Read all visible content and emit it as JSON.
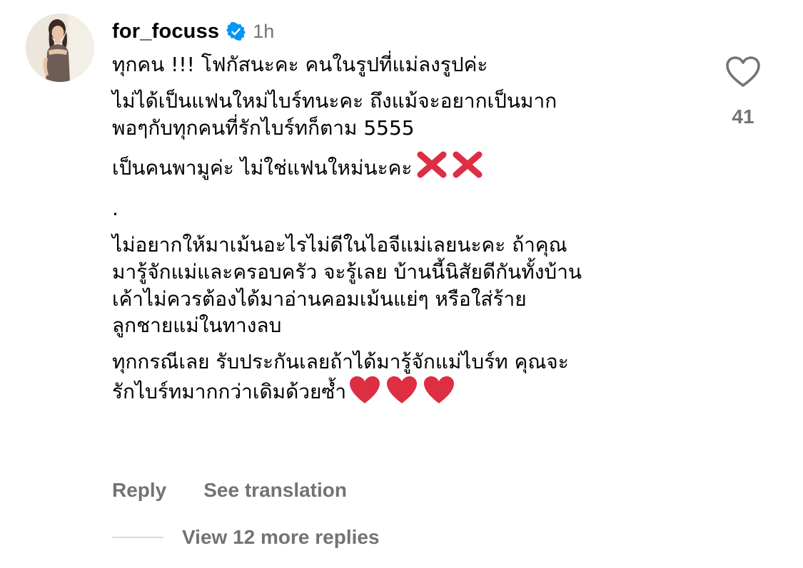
{
  "comment": {
    "username": "for_focuss",
    "verified_icon": "verified-badge-icon",
    "time": "1h",
    "paragraphs": [
      {
        "lines": [
          "ทุกคน !!! โฟกัสนะคะ คนในรูปที่แม่ลงรูปค่ะ"
        ]
      },
      {
        "lines": [
          "ไม่ได้เป็นแฟนใหม่ไบร์ทนะคะ ถึงแม้จะอยากเป็นมาก",
          "พอๆกับทุกคนที่รักไบร์ทก็ตาม 5555"
        ]
      },
      {
        "lines": [
          "เป็นคนพามูค่ะ ไม่ใช่แฟนใหม่นะคะ"
        ]
      },
      {
        "lines": [
          "."
        ]
      },
      {
        "lines": [
          "ไม่อยากให้มาเม้นอะไรไม่ดีในไอจีแม่เลยนะคะ ถ้าคุณ",
          "มารู้จักแม่และครอบครัว จะรู้เลย บ้านนี้นิสัยดีกันทั้งบ้าน",
          "เค้าไม่ควรต้องได้มาอ่านคอมเม้นแย่ๆ หรือใส่ร้าย",
          "ลูกชายแม่ในทางลบ"
        ]
      },
      {
        "lines": [
          "ทุกกรณีเลย รับประกันเลยถ้าได้มารู้จักแม่ไบร์ท คุณจะ",
          "รักไบร์ทมากกว่าเดิมด้วยซ้ำ"
        ]
      }
    ],
    "emoji": {
      "cross": "cross-mark-emoji",
      "heart": "red-heart-emoji"
    },
    "like_icon": "heart-outline-icon",
    "like_count": "41",
    "actions": {
      "reply": "Reply",
      "see_translation": "See translation"
    },
    "view_replies": "View 12 more replies"
  },
  "colors": {
    "text_primary": "#000000",
    "text_secondary": "#737373",
    "verified_blue": "#0095f6",
    "emoji_red": "#dd2e44",
    "divider": "#dbdbdb"
  }
}
